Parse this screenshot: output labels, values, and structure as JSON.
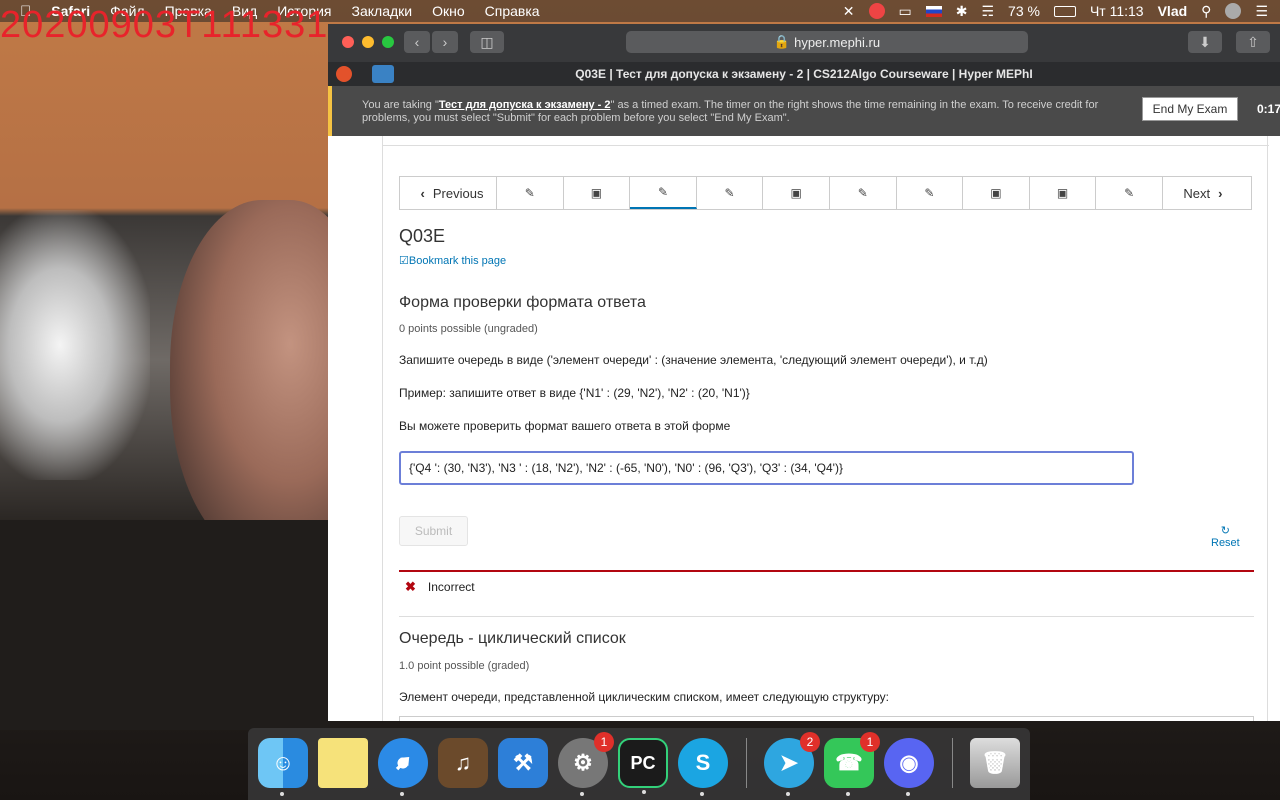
{
  "overlay": {
    "timestamp": "20200903T111331"
  },
  "menubar": {
    "apple": "",
    "items": [
      "Safari",
      "Файл",
      "Правка",
      "Вид",
      "История",
      "Закладки",
      "Окно",
      "Справка"
    ],
    "battery": "73 %",
    "clock": "Чт 11:13",
    "user": "Vlad"
  },
  "browser": {
    "address": "hyper.mephi.ru",
    "tab_title": "Q03E | Тест для допуска к экзамену - 2 | CS212Algo Courseware | Hyper MEPhI"
  },
  "exam_banner": {
    "msg_prefix": "You are taking \"",
    "exam_name": "Тест для допуска к экзамену - 2",
    "msg_suffix": "\" as a timed exam. The timer on the right shows the time remaining in the exam. To receive credit for problems, you must select \"Submit\" for each problem before you select \"End My Exam\".",
    "end_button": "End My Exam",
    "timer": "0:17:"
  },
  "sequence_nav": {
    "prev": "Previous",
    "next": "Next"
  },
  "unit": {
    "title": "Q03E",
    "bookmark": "Bookmark this page"
  },
  "problem1": {
    "title": "Форма проверки формата ответа",
    "points": "0 points possible (ungraded)",
    "text1": "Запишите очередь в виде ('элемент очереди' : (значение элемента, 'следующий элемент очереди'), и т.д)",
    "text2": "Пример: запишите ответ в виде {'N1' : (29, 'N2'), 'N2' : (20, 'N1')}",
    "text3": "Вы можете проверить формат вашего ответа в этой форме",
    "answer": "{'Q4 ': (30, 'N3'), 'N3 ' : (18, 'N2'), 'N2' : (-65, 'N0'), 'N0' : (96, 'Q3'), 'Q3' : (34, 'Q4')}",
    "submit": "Submit",
    "reset": "Reset",
    "status": "Incorrect"
  },
  "problem2": {
    "title": "Очередь - циклический список",
    "points": "1.0 point possible (graded)",
    "text1": "Элемент очереди, представленной циклическим списком, имеет следующую структуру:"
  },
  "dock": {
    "badges": {
      "system_prefs": "1",
      "telegram": "2",
      "facetime": "1"
    }
  }
}
